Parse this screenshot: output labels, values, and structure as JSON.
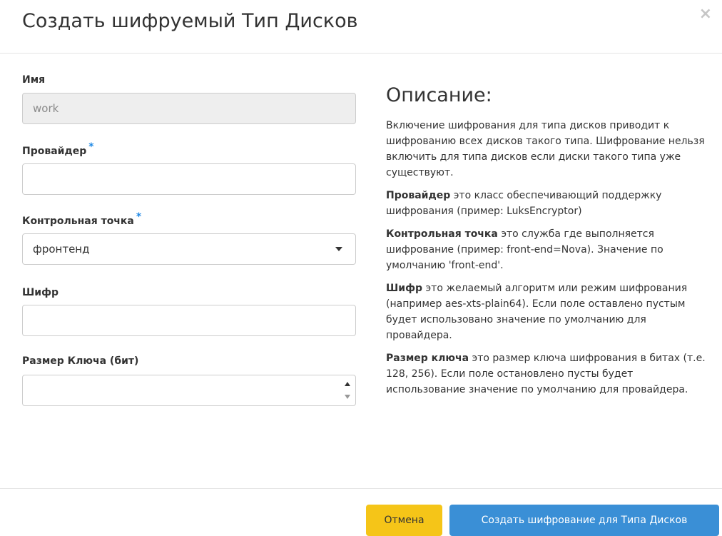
{
  "modal": {
    "title": "Создать шифруемый Тип Дисков",
    "close_glyph": "×"
  },
  "form": {
    "name": {
      "label": "Имя",
      "value": "work"
    },
    "provider": {
      "label": "Провайдер",
      "required": "*",
      "value": ""
    },
    "control_location": {
      "label": "Контрольная точка",
      "required": "*",
      "selected": "фронтенд"
    },
    "cipher": {
      "label": "Шифр",
      "value": ""
    },
    "key_size": {
      "label": "Размер Ключа (бит)",
      "value": ""
    }
  },
  "description": {
    "title": "Описание:",
    "intro": "Включение шифрования для типа дисков приводит к шифрованию всех дисков такого типа. Шифрование нельзя включить для типа дисков если диски такого типа уже существуют.",
    "provider_term": "Провайдер",
    "provider_text": " это класс обеспечивающий поддержку шифрования (пример: LuksEncryptor)",
    "control_term": "Контрольная точка",
    "control_text": " это служба где выполняется шифрование (пример: front-end=Nova). Значение по умолчанию 'front-end'.",
    "cipher_term": "Шифр",
    "cipher_text": " это желаемый алгоритм или режим шифрования (например aes-xts-plain64). Если поле оставлено пустым будет использовано значение по умолчанию для провайдера.",
    "keysize_term": "Размер ключа",
    "keysize_text": " это размер ключа шифрования в битах (т.е. 128, 256). Если поле остановлено пусты будет использование значение по умолчанию для провайдера."
  },
  "footer": {
    "cancel_label": "Отмена",
    "submit_label": "Создать шифрование для Типа Дисков"
  },
  "colors": {
    "required_asterisk": "#1e88e5",
    "cancel_button": "#f5c518",
    "primary_button": "#3a8fd6"
  },
  "icons": {
    "close": "close-icon",
    "select_caret": "chevron-down-icon",
    "spinner_up": "caret-up-icon",
    "spinner_down": "caret-down-icon"
  }
}
